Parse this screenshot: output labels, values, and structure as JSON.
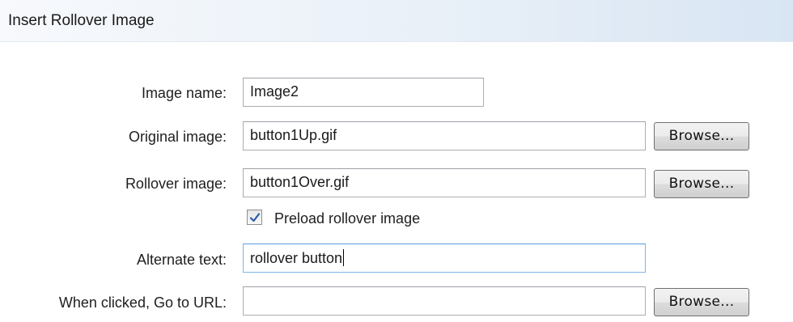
{
  "dialog": {
    "title": "Insert Rollover Image"
  },
  "form": {
    "image_name": {
      "label": "Image name:",
      "value": "Image2"
    },
    "original_image": {
      "label": "Original image:",
      "value": "button1Up.gif",
      "browse_label": "Browse..."
    },
    "rollover_image": {
      "label": "Rollover image:",
      "value": "button1Over.gif",
      "browse_label": "Browse..."
    },
    "preload": {
      "label": "Preload rollover image",
      "checked": true
    },
    "alternate_text": {
      "label": "Alternate text:",
      "value": "rollover button"
    },
    "goto_url": {
      "label": "When clicked, Go to URL:",
      "value": "",
      "browse_label": "Browse..."
    }
  },
  "icons": {
    "checkmark": "checkmark-icon"
  },
  "colors": {
    "titlebar_gradient_end": "#d8e5f3",
    "focus_border": "#7eb4ea"
  }
}
